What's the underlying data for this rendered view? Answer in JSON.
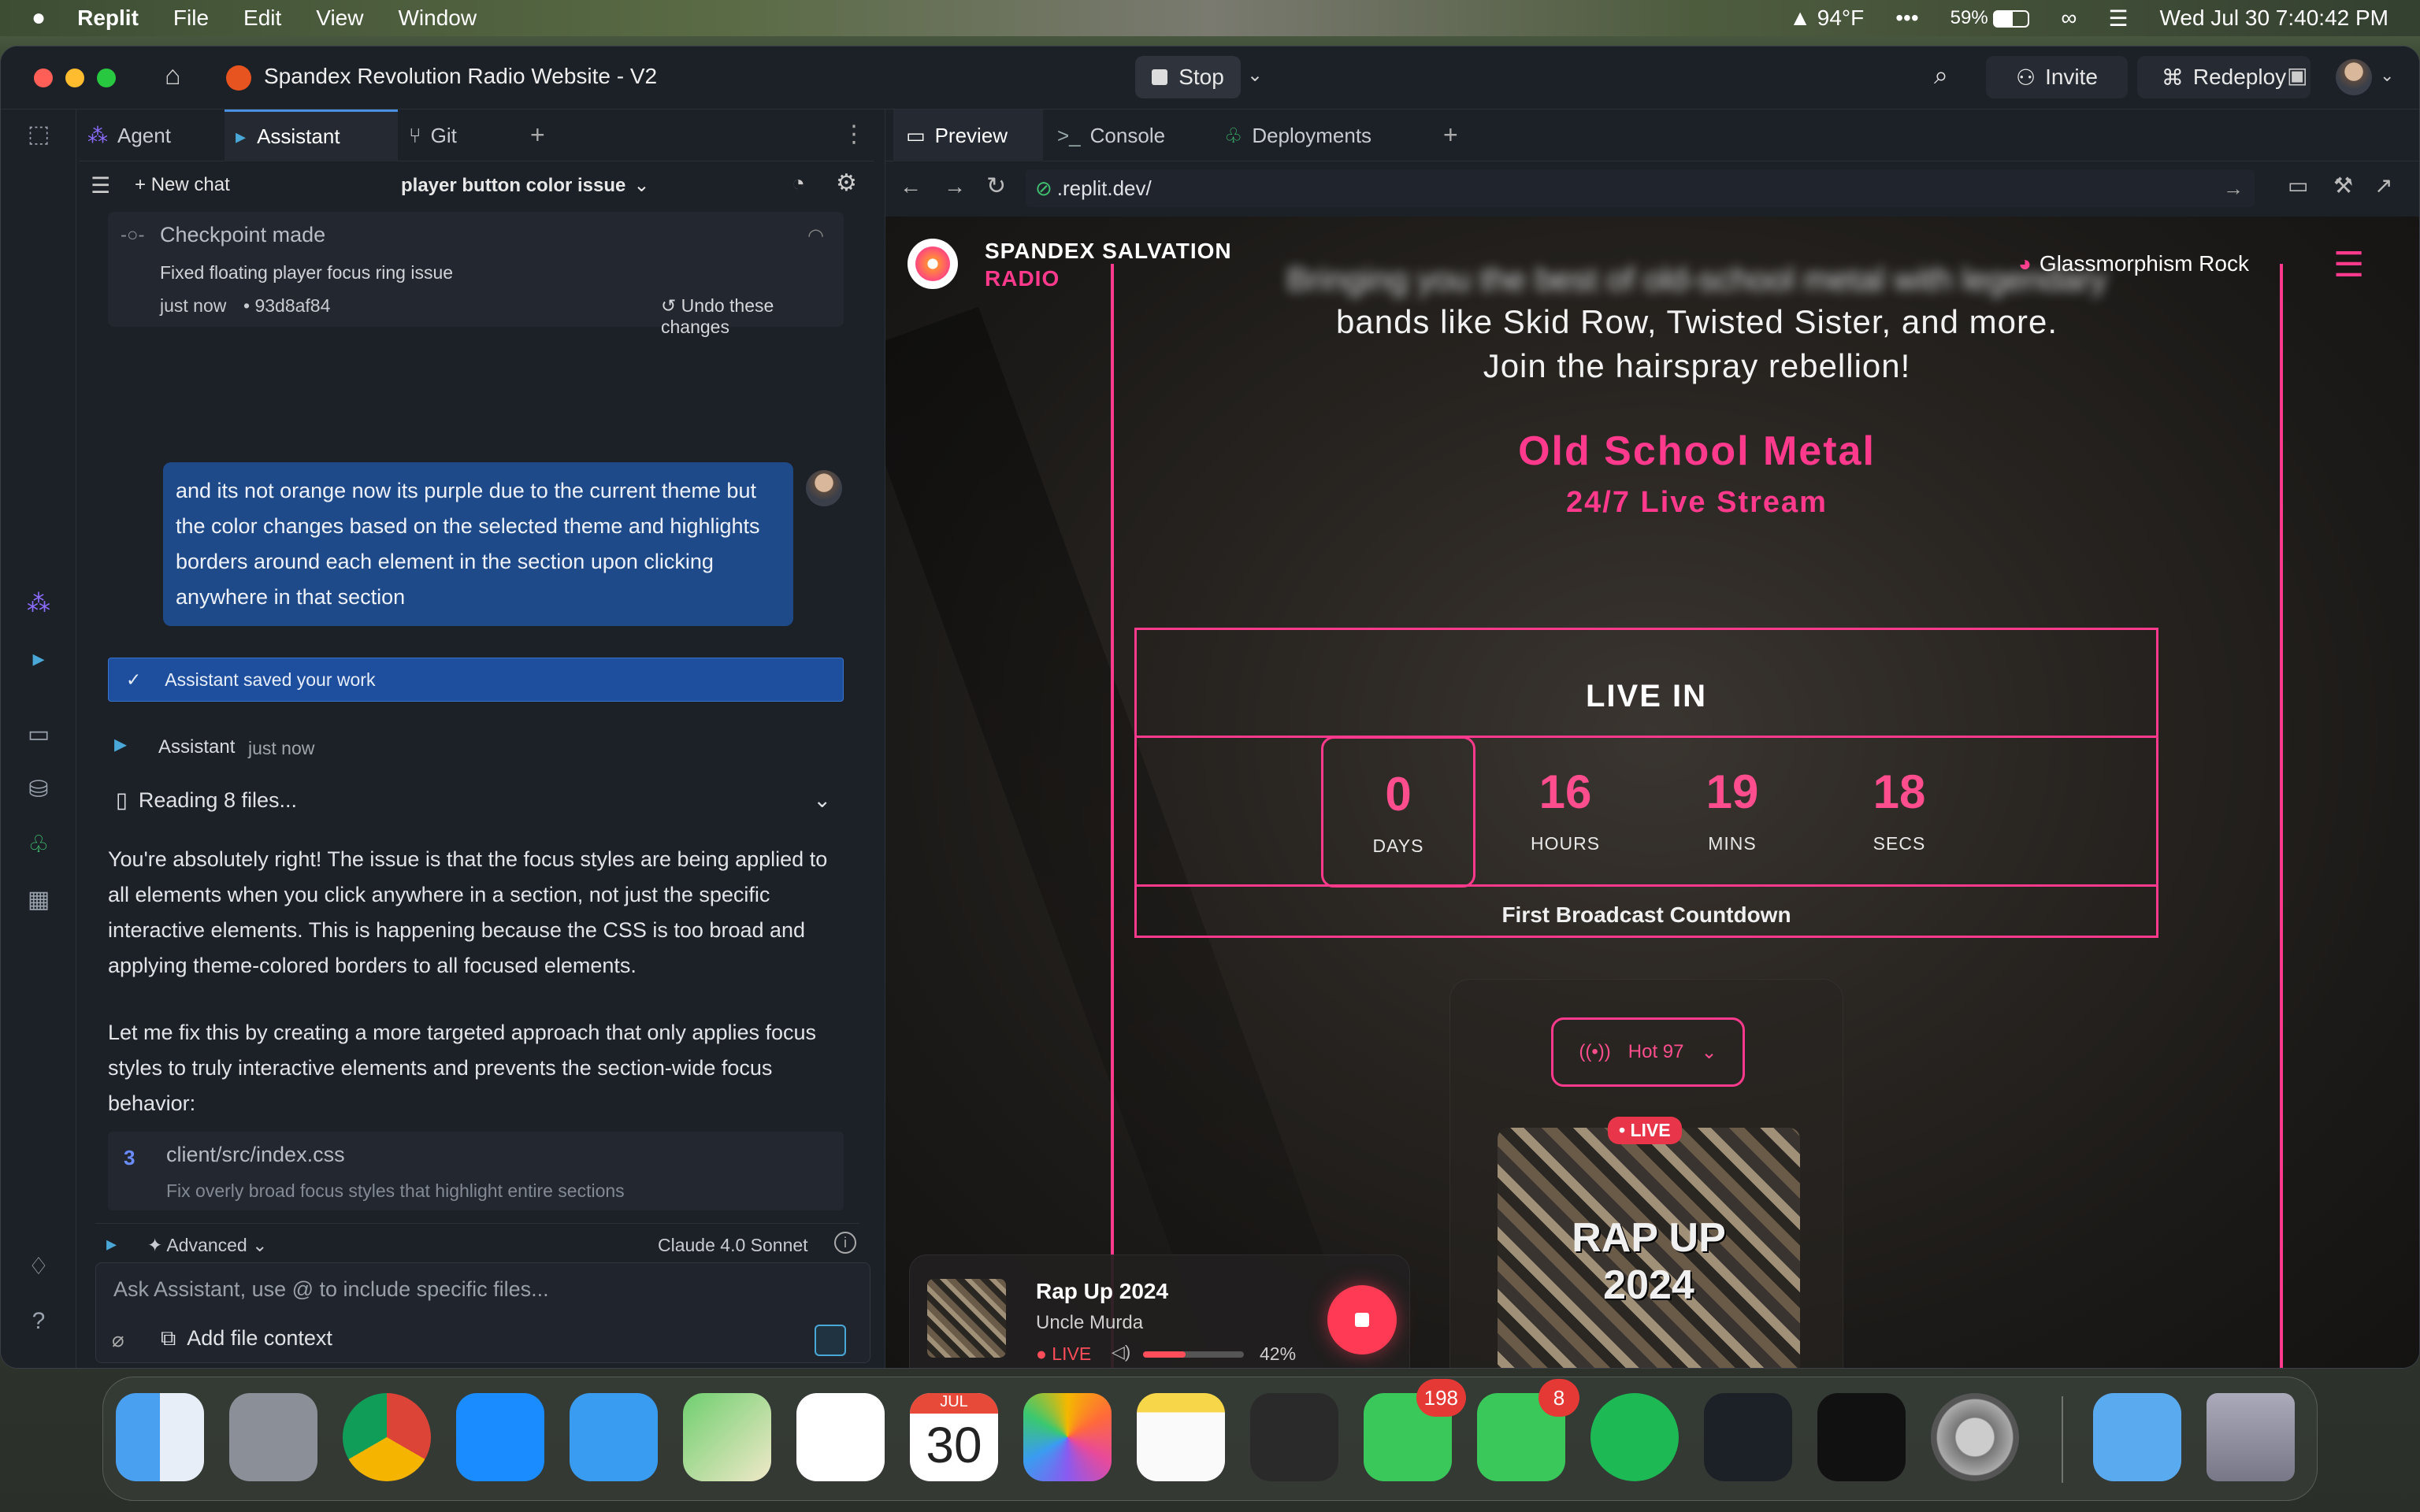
{
  "menubar": {
    "app": "Replit",
    "items": [
      "File",
      "Edit",
      "View",
      "Window"
    ],
    "weather": "94°F",
    "battery": "59%",
    "datetime": "Wed Jul 30  7:40:42 PM"
  },
  "window": {
    "title": "Spandex Revolution Radio Website - V2",
    "stop_label": "Stop",
    "invite_label": "Invite",
    "redeploy_label": "Redeploy"
  },
  "left_tabs": {
    "agent": "Agent",
    "assistant": "Assistant",
    "git": "Git"
  },
  "chat_toolbar": {
    "new_chat": "New chat",
    "chat_title": "player button color issue"
  },
  "checkpoint": {
    "title": "Checkpoint made",
    "desc": "Fixed floating player focus ring issue",
    "time": "just now",
    "hash": "93d8af84",
    "undo": "Undo these changes"
  },
  "user_message": "and its not orange now its purple due to the current theme but the color changes based on the selected theme and highlights borders around each element in the section upon clicking anywhere in that section",
  "saved_banner": "Assistant saved your work",
  "assistant_meta": {
    "name": "Assistant",
    "time": "just now"
  },
  "reading_files": "Reading 8 files...",
  "assistant_reply": {
    "p1": "You're absolutely right! The issue is that the focus styles are being applied to all elements when you click anywhere in a section, not just the specific interactive elements. This is happening because the CSS is too broad and applying theme-colored borders to all focused elements.",
    "p2": "Let me fix this by creating a more targeted approach that only applies focus styles to truly interactive elements and prevents the section-wide focus behavior:"
  },
  "file_card": {
    "path": "client/src/index.css",
    "desc": "Fix overly broad focus styles that highlight entire sections"
  },
  "input_area": {
    "advanced": "Advanced",
    "model": "Claude 4.0 Sonnet",
    "placeholder": "Ask Assistant, use @ to include specific files...",
    "add_context": "Add file context"
  },
  "preview_tabs": {
    "preview": "Preview",
    "console": "Console",
    "deployments": "Deployments"
  },
  "url": ".replit.dev/",
  "site": {
    "brand_line1": "SPANDEX SALVATION",
    "brand_line2": "RADIO",
    "theme_name": "Glassmorphism Rock",
    "blurred_line": "Bringing you the best of old-school metal with legendary",
    "hero_line1": "bands like Skid Row, Twisted Sister, and more.",
    "hero_line2": "Join the hairspray rebellion!",
    "genre": "Old School Metal",
    "stream": "24/7 Live Stream",
    "live_in": "LIVE IN",
    "countdown": [
      {
        "value": "0",
        "label": "DAYS"
      },
      {
        "value": "16",
        "label": "HOURS"
      },
      {
        "value": "19",
        "label": "MINS"
      },
      {
        "value": "18",
        "label": "SECS"
      }
    ],
    "countdown_caption": "First Broadcast Countdown",
    "station": "Hot 97",
    "live_badge": "• LIVE",
    "cover_text": "RAP UP 2024"
  },
  "player": {
    "title": "Rap Up 2024",
    "artist": "Uncle Murda",
    "live": "LIVE",
    "volume": "42%",
    "volume_level": 0.42
  },
  "dock": {
    "calendar_month": "JUL",
    "calendar_day": "30",
    "messages_badge": "198",
    "facetime_badge": "8"
  }
}
